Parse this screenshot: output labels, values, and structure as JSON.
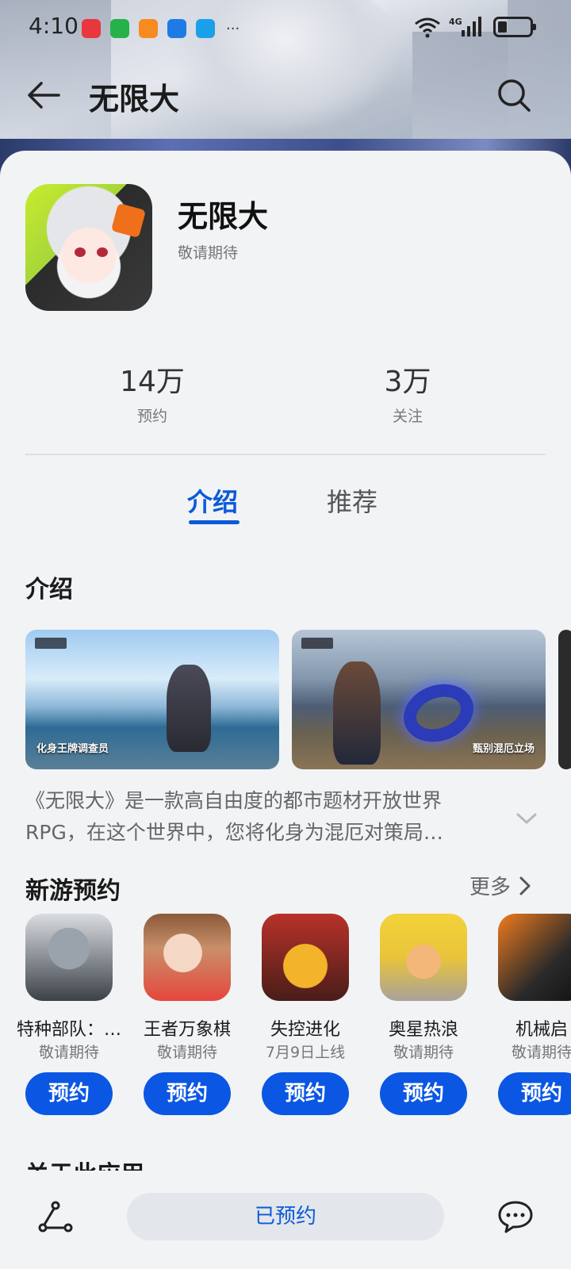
{
  "status_bar": {
    "time": "4:10",
    "network": "4G",
    "app_icons": [
      {
        "icon": "huawei-mall-icon",
        "color": "#e8383d"
      },
      {
        "icon": "game-center-icon",
        "color": "#26b14b"
      },
      {
        "icon": "video-player-icon",
        "color": "#f78b1f"
      },
      {
        "icon": "weather-icon",
        "color": "#1e7be6"
      },
      {
        "icon": "search-app-icon",
        "color": "#1aa0e8"
      }
    ],
    "overflow": "···"
  },
  "topbar": {
    "title": "无限大"
  },
  "app": {
    "name": "无限大",
    "status": "敬请期待"
  },
  "stats": [
    {
      "value": "14万",
      "label": "预约"
    },
    {
      "value": "3万",
      "label": "关注"
    }
  ],
  "tabs": [
    {
      "label": "介绍",
      "active": true
    },
    {
      "label": "推荐",
      "active": false
    }
  ],
  "intro": {
    "title": "介绍",
    "screenshots": [
      {
        "caption": "化身王牌调查员"
      },
      {
        "caption": "甄别混厄立场"
      }
    ],
    "description_lines": [
      "《无限大》是一款高自由度的都市题材开放世界",
      "RPG，在这个世界中，您将化身为混厄对策局…"
    ]
  },
  "new_games": {
    "title": "新游预约",
    "more_label": "更多",
    "items": [
      {
        "name": "特种部队：…",
        "sub": "敬请期待",
        "button": "预约"
      },
      {
        "name": "王者万象棋",
        "sub": "敬请期待",
        "button": "预约"
      },
      {
        "name": "失控进化",
        "sub": "7月9日上线",
        "button": "预约"
      },
      {
        "name": "奥星热浪",
        "sub": "敬请期待",
        "button": "预约"
      },
      {
        "name": "机械启",
        "sub": "敬请期待",
        "button": "预约"
      }
    ]
  },
  "about": {
    "title": "关于此应用"
  },
  "bottom": {
    "cta": "已预约"
  },
  "colors": {
    "accent": "#0b5ad8",
    "button": "#0b57e3"
  }
}
